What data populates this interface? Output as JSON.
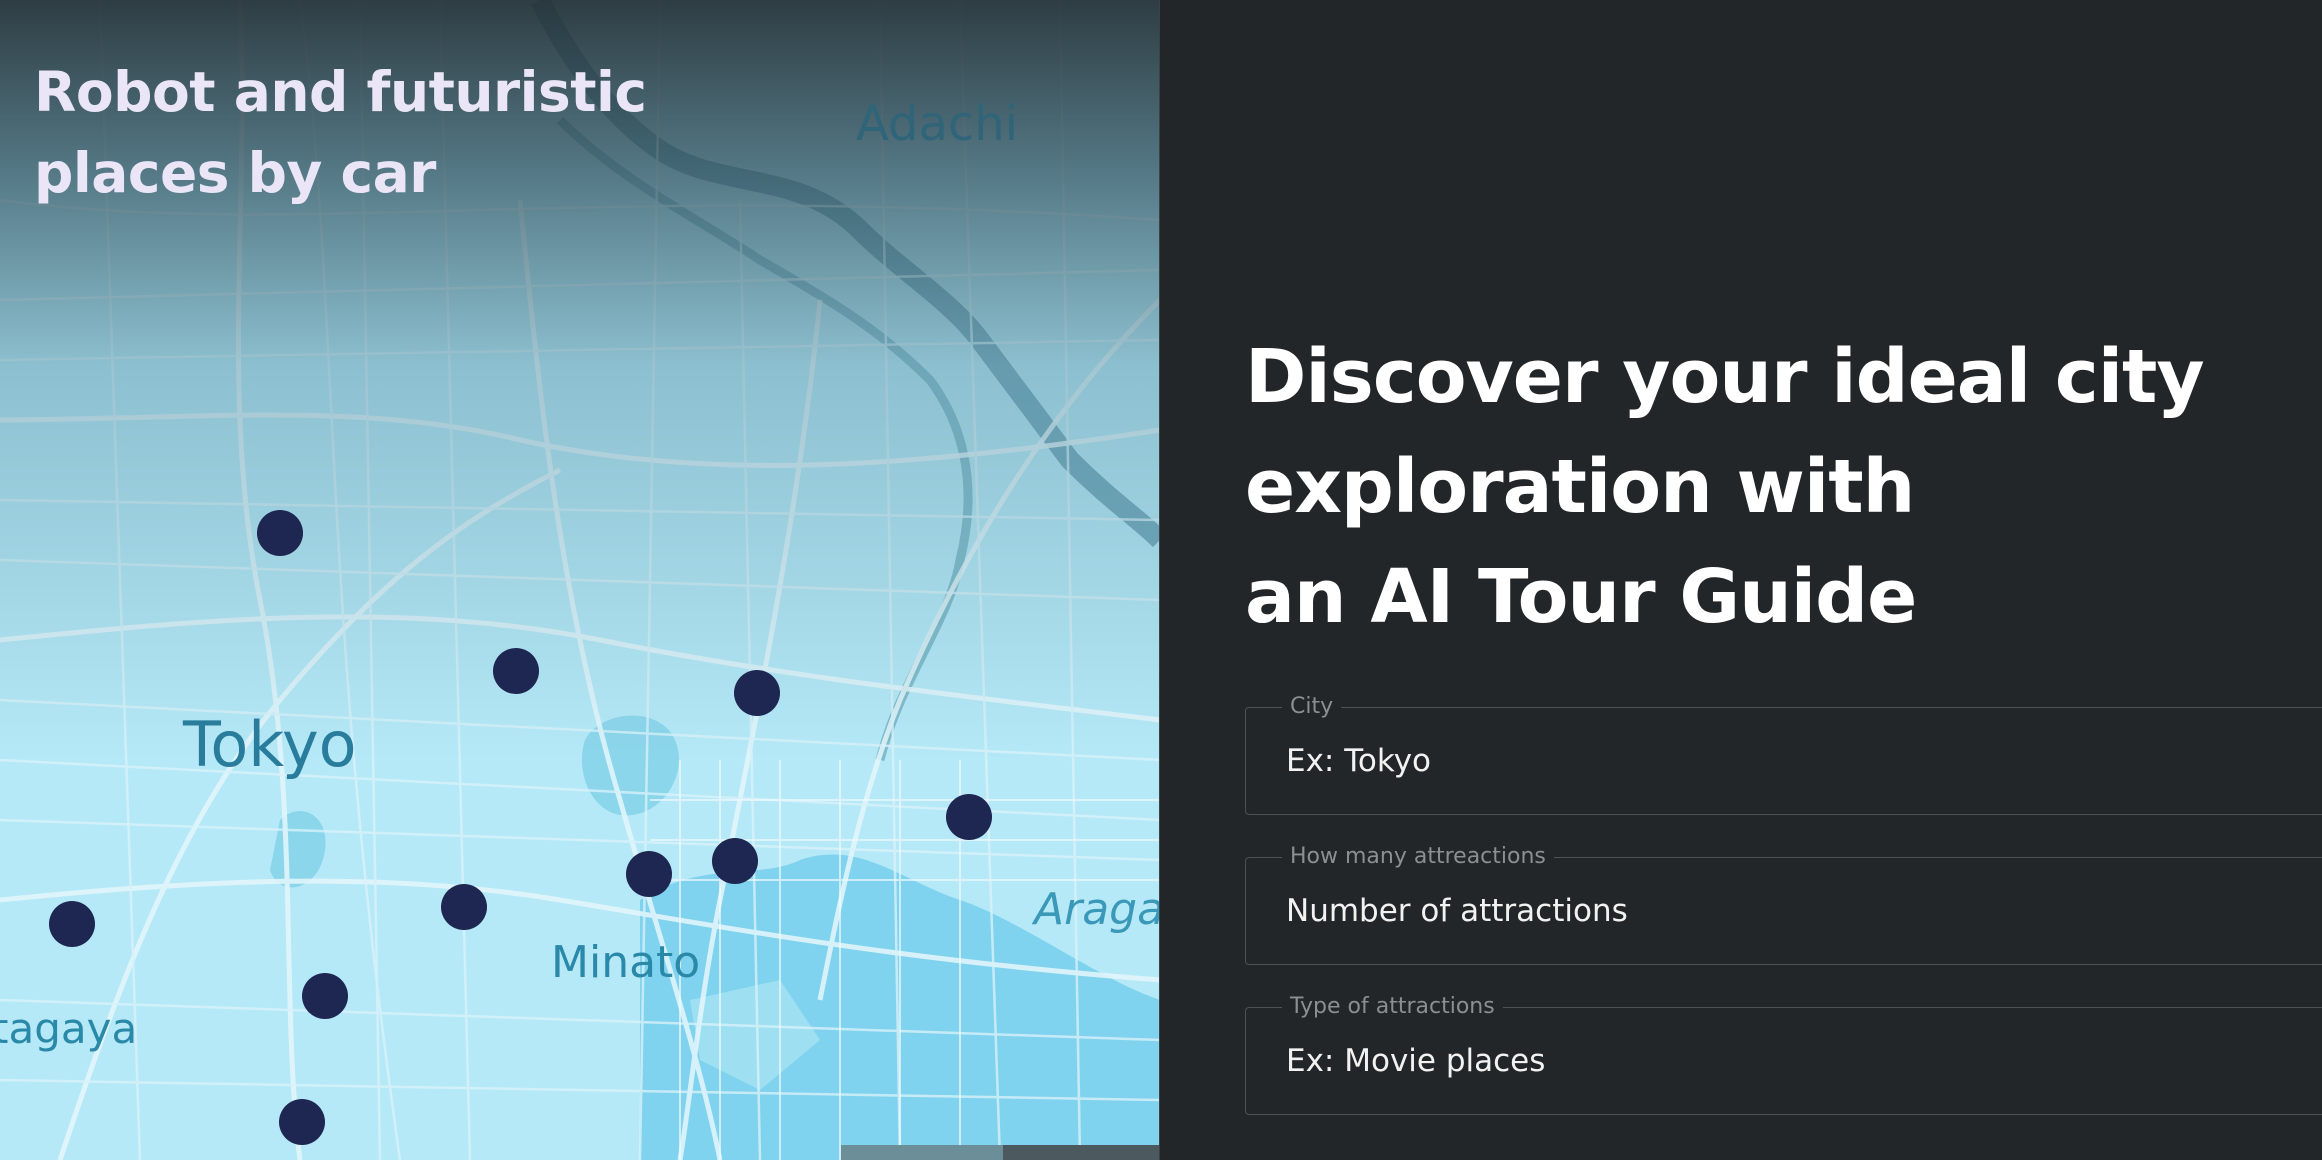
{
  "card": {
    "title": "Robot and futuristic places by car"
  },
  "map": {
    "labels": {
      "adachi": "Adachi",
      "tokyo": "Tokyo",
      "minato": "Minato",
      "setagaya": "tagaya",
      "arakawa": "Aragaw"
    },
    "pin_color": "#1e2652"
  },
  "hero": {
    "line1": "Discover your ideal city",
    "line2": "exploration with",
    "line3": "an AI Tour Guide"
  },
  "form": {
    "city": {
      "legend": "City",
      "placeholder": "Ex: Tokyo"
    },
    "count": {
      "legend": "How many attreactions",
      "placeholder": "Number of attractions"
    },
    "type": {
      "legend": "Type of attractions",
      "placeholder": "Ex: Movie places"
    }
  },
  "colors": {
    "background": "#232628",
    "map_water": "#a8e3f3",
    "title_text": "#ebe6f7"
  }
}
